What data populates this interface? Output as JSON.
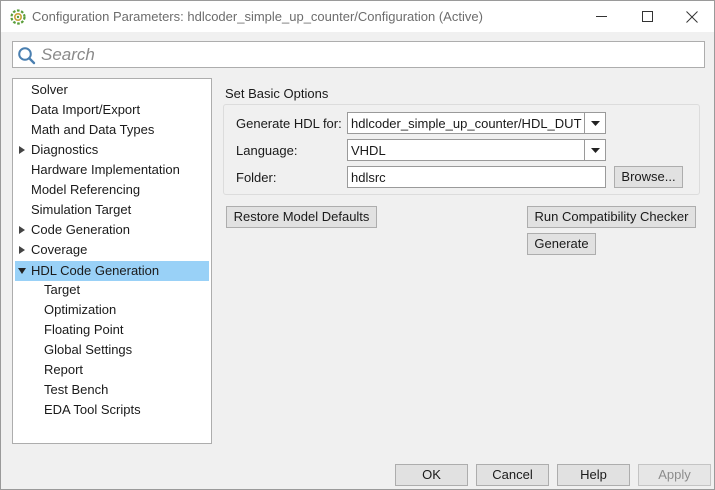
{
  "window": {
    "title": "Configuration Parameters: hdlcoder_simple_up_counter/Configuration (Active)"
  },
  "search": {
    "placeholder": "Search"
  },
  "tree": {
    "items": [
      {
        "label": "Solver"
      },
      {
        "label": "Data Import/Export"
      },
      {
        "label": "Math and Data Types"
      },
      {
        "label": "Diagnostics"
      },
      {
        "label": "Hardware Implementation"
      },
      {
        "label": "Model Referencing"
      },
      {
        "label": "Simulation Target"
      },
      {
        "label": "Code Generation"
      },
      {
        "label": "Coverage"
      },
      {
        "label": "HDL Code Generation"
      },
      {
        "label": "Target"
      },
      {
        "label": "Optimization"
      },
      {
        "label": "Floating Point"
      },
      {
        "label": "Global Settings"
      },
      {
        "label": "Report"
      },
      {
        "label": "Test Bench"
      },
      {
        "label": "EDA Tool Scripts"
      }
    ],
    "selected_color": "#99d1f7"
  },
  "basic_options": {
    "title": "Set Basic Options",
    "generate_for_label": "Generate HDL for:",
    "generate_for_value": "hdlcoder_simple_up_counter/HDL_DUT",
    "language_label": "Language:",
    "language_value": "VHDL",
    "folder_label": "Folder:",
    "folder_value": "hdlsrc",
    "browse_label": "Browse..."
  },
  "actions": {
    "restore_defaults": "Restore Model Defaults",
    "run_checker": "Run Compatibility Checker",
    "generate": "Generate"
  },
  "footer": {
    "ok": "OK",
    "cancel": "Cancel",
    "help": "Help",
    "apply": "Apply"
  }
}
